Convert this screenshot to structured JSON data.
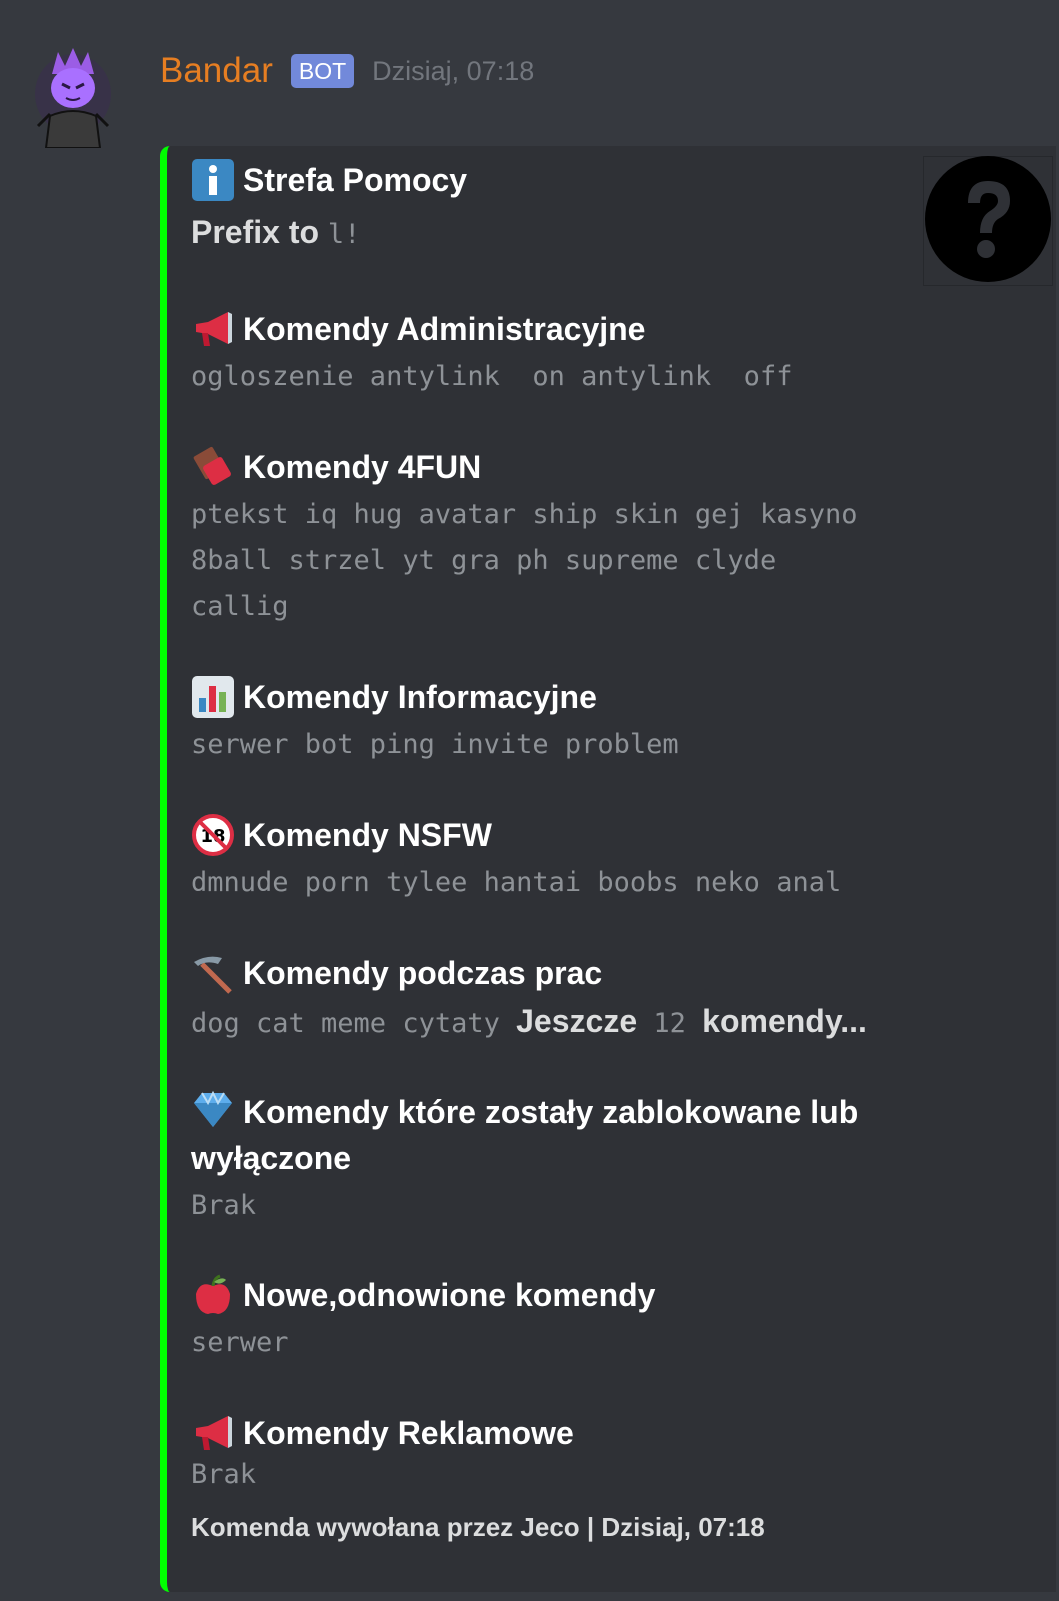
{
  "message": {
    "username": "Bandar",
    "bot_tag": "BOT",
    "timestamp": "Dzisiaj, 07:18"
  },
  "embed": {
    "accent_color": "#00ff00",
    "title_icon": "information-icon",
    "title": "Strefa Pomocy",
    "description_text": "Prefix to ",
    "prefix": "l!",
    "thumbnail_icon": "question-mark-icon",
    "fields": [
      {
        "icon": "megaphone-icon",
        "name": "Komendy Administracyjne",
        "value": "ogloszenie antylink  on antylink  off"
      },
      {
        "icon": "chocolate-bar-icon",
        "name": "Komendy 4FUN",
        "value": "ptekst iq hug avatar ship skin gej kasyno 8ball strzel yt gra ph supreme clyde callig"
      },
      {
        "icon": "bar-chart-icon",
        "name": "Komendy Informacyjne",
        "value": "serwer bot ping invite problem"
      },
      {
        "icon": "no-under-18-icon",
        "name": "Komendy NSFW",
        "value": "dmnude porn tylee hantai boobs neko anal"
      },
      {
        "icon": "pick-icon",
        "name": "Komendy podczas prac",
        "value": "dog cat meme cytaty",
        "more_prefix": "Jeszcze",
        "more_count": "12",
        "more_suffix": "komendy..."
      },
      {
        "icon": "gem-icon",
        "name": "Komendy które zostały zablokowane lub wyłączone",
        "value": "Brak"
      },
      {
        "icon": "apple-icon",
        "name": "Nowe,odnowione komendy",
        "value": "serwer"
      },
      {
        "icon": "megaphone-icon",
        "name": "Komendy Reklamowe",
        "value": "Brak"
      }
    ],
    "footer": "Komenda wywołana przez Jeco | Dzisiaj, 07:18"
  }
}
